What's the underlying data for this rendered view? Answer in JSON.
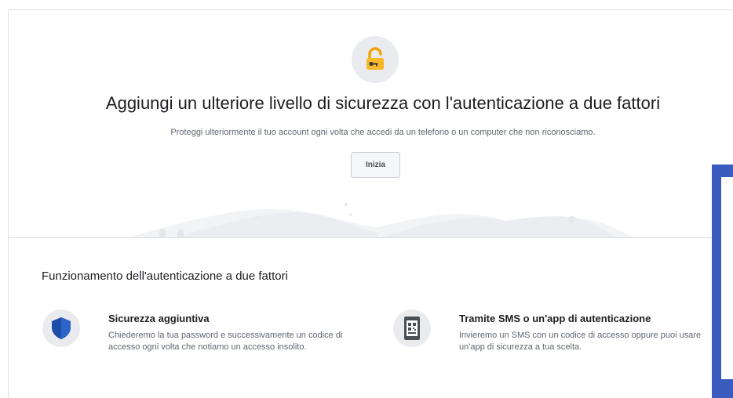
{
  "hero": {
    "icon": "lock-icon",
    "title": "Aggiungi un ulteriore livello di sicurezza con l'autenticazione a due fattori",
    "subtitle": "Proteggi ulteriormente il tuo account ogni volta che accedi da un telefono o un computer che non riconosciamo.",
    "start_button": "Inizia"
  },
  "how": {
    "title": "Funzionamento dell'autenticazione a due fattori",
    "features": [
      {
        "icon": "shield-icon",
        "title": "Sicurezza aggiuntiva",
        "description": "Chiederemo la tua password e successivamente un codice di accesso ogni volta che notiamo un accesso insolito."
      },
      {
        "icon": "phone-qr-icon",
        "title": "Tramite SMS o un'app di autenticazione",
        "description": "Invieremo un SMS con un codice di accesso oppure puoi usare un'app di sicurezza a tua scelta."
      }
    ]
  },
  "colors": {
    "accent_blue": "#3b5cbf",
    "lock_yellow": "#f7b928",
    "shield_blue": "#1877f2"
  }
}
